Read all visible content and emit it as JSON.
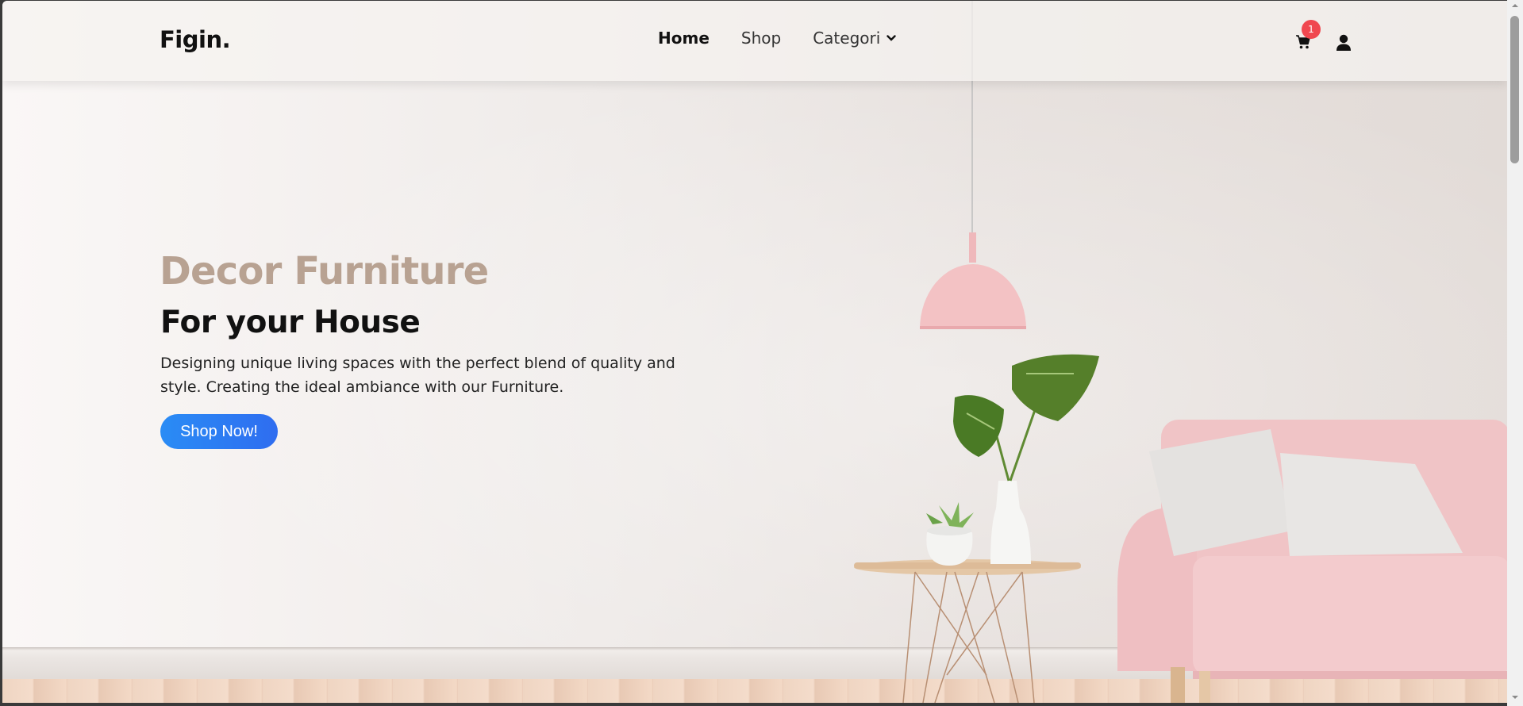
{
  "header": {
    "logo": "Figin.",
    "nav": [
      {
        "label": "Home",
        "active": true
      },
      {
        "label": "Shop",
        "active": false
      },
      {
        "label": "Categori",
        "active": false,
        "dropdown": true
      }
    ],
    "cart_count": "1",
    "icons": {
      "cart": "cart-icon",
      "user": "user-icon",
      "dropdown": "chevron-down-icon"
    }
  },
  "hero": {
    "kicker": "Decor Furniture",
    "title": "For your House",
    "description": "Designing unique living spaces with the perfect blend of quality and style. Creating the ideal ambiance with our Furniture.",
    "cta": "Shop Now!"
  },
  "colors": {
    "accent": "#2a8cf5",
    "kicker": "#b8a292",
    "badge": "#f0474f",
    "sofa": "#f0c4c6",
    "lamp": "#f2bfc1"
  }
}
